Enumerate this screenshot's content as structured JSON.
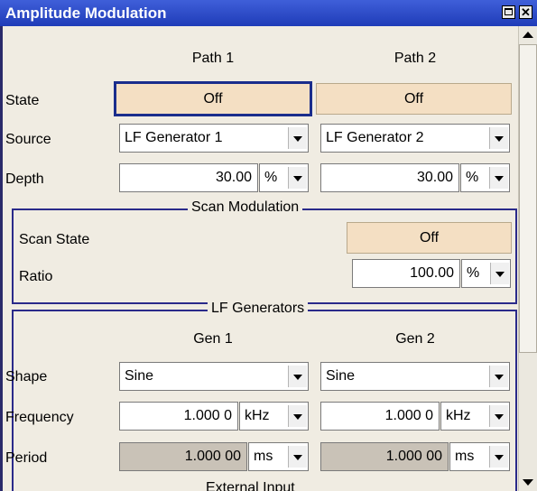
{
  "window": {
    "title": "Amplitude Modulation"
  },
  "paths": {
    "path1": "Path 1",
    "path2": "Path 2"
  },
  "rows": {
    "state": {
      "label": "State",
      "path1": "Off",
      "path2": "Off"
    },
    "source": {
      "label": "Source",
      "path1": "LF Generator 1",
      "path2": "LF Generator 2"
    },
    "depth": {
      "label": "Depth",
      "path1_value": "30.00",
      "path1_unit": "%",
      "path2_value": "30.00",
      "path2_unit": "%"
    }
  },
  "scan": {
    "title": "Scan Modulation",
    "state_label": "Scan State",
    "state_value": "Off",
    "ratio_label": "Ratio",
    "ratio_value": "100.00",
    "ratio_unit": "%"
  },
  "lf": {
    "title": "LF Generators",
    "gen1": "Gen 1",
    "gen2": "Gen 2",
    "shape_label": "Shape",
    "shape1": "Sine",
    "shape2": "Sine",
    "freq_label": "Frequency",
    "freq1": "1.000 0",
    "freq1_unit": "kHz",
    "freq2": "1.000 0",
    "freq2_unit": "kHz",
    "period_label": "Period",
    "period1": "1.000 00",
    "period1_unit": "ms",
    "period2": "1.000 00",
    "period2_unit": "ms"
  },
  "next_section": "External Input"
}
